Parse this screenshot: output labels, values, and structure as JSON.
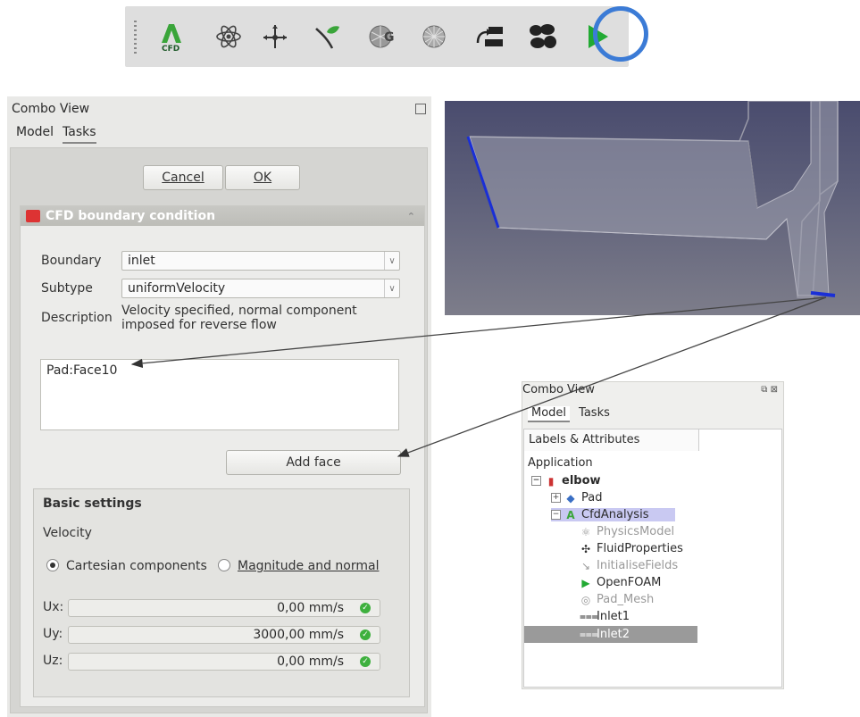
{
  "toolbar": {
    "buttons": [
      {
        "name": "cfd-analysis-icon",
        "label": "CFD"
      },
      {
        "name": "physics-model-icon"
      },
      {
        "name": "fluid-properties-icon"
      },
      {
        "name": "initialise-fields-icon"
      },
      {
        "name": "gmsh-mesh-icon"
      },
      {
        "name": "mesh-icon"
      },
      {
        "name": "fluid-boundary-icon"
      },
      {
        "name": "porous-zone-icon"
      },
      {
        "name": "run-solver-icon"
      }
    ],
    "highlight_color": "#3b7bd6"
  },
  "left_combo": {
    "title": "Combo View",
    "tabs": [
      "Model",
      "Tasks"
    ],
    "cancel_label": "Cancel",
    "ok_label": "OK",
    "panel_title": "CFD boundary condition",
    "boundary_label": "Boundary",
    "boundary_value": "inlet",
    "subtype_label": "Subtype",
    "subtype_value": "uniformVelocity",
    "description_label": "Description",
    "description_line1": "Velocity specified, normal component",
    "description_line2": "imposed for reverse flow",
    "faces": [
      "Pad:Face10"
    ],
    "add_face_label": "Add face",
    "basic_settings_title": "Basic settings",
    "velocity_label": "Velocity",
    "radio_cartesian": "Cartesian components",
    "radio_magnitude": "Magnitude and normal",
    "ux_label": "Ux:",
    "ux_value": "0,00 mm/s",
    "uy_label": "Uy:",
    "uy_value": "3000,00 mm/s",
    "uz_label": "Uz:",
    "uz_value": "0,00 mm/s"
  },
  "right_combo": {
    "title": "Combo View",
    "tabs": [
      "Model",
      "Tasks"
    ],
    "tree_header": "Labels & Attributes",
    "root": "Application",
    "items": [
      {
        "label": "elbow"
      },
      {
        "label": "Pad"
      },
      {
        "label": "CfdAnalysis"
      },
      {
        "label": "PhysicsModel"
      },
      {
        "label": "FluidProperties"
      },
      {
        "label": "InitialiseFields"
      },
      {
        "label": "OpenFOAM"
      },
      {
        "label": "Pad_Mesh"
      },
      {
        "label": "Inlet1"
      },
      {
        "label": "Inlet2"
      }
    ]
  },
  "colors": {
    "accent_blue": "#3b7bd6",
    "check_green": "#3eb03e",
    "selected_bg": "#9a9a9a",
    "analysis_bg": "#c9c9f2"
  }
}
